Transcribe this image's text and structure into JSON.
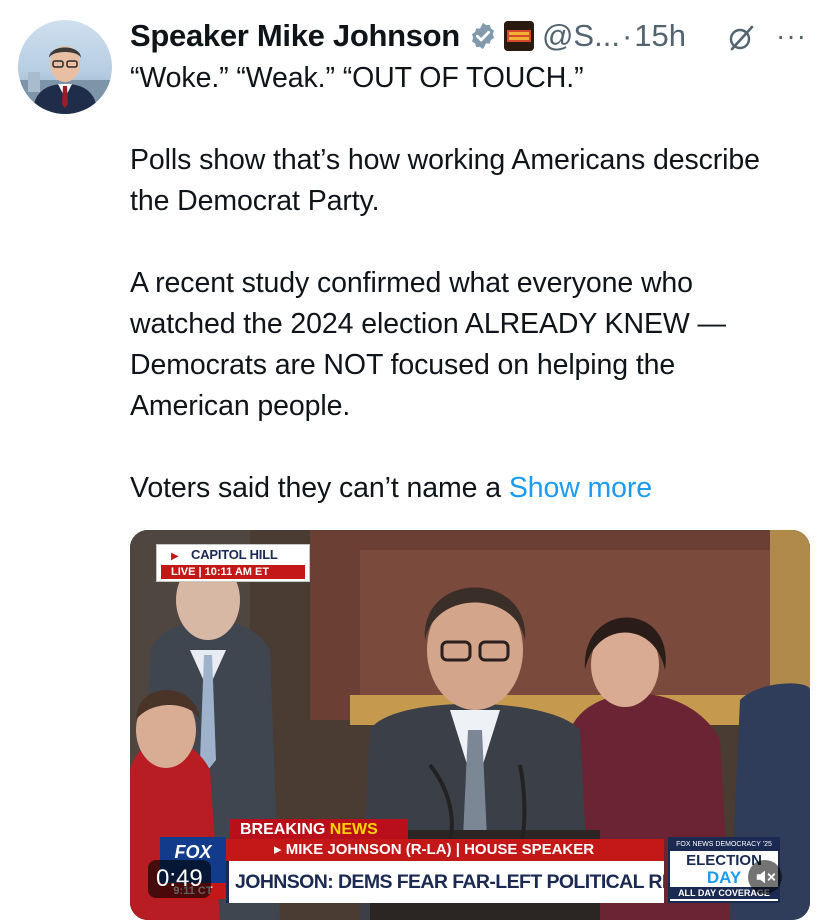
{
  "tweet": {
    "display_name": "Speaker Mike Johnson",
    "handle": "@S...",
    "separator": "·",
    "time": "15h",
    "more_label": "···",
    "body": "“Woke.” “Weak.” “OUT OF TOUCH.”\n\nPolls show that’s how working Americans describe the Democrat Party.\n\nA recent study confirmed what everyone who watched the 2024 election ALREADY KNEW — Democrats are NOT focused on helping the American people.\n\nVoters said they can’t name a ",
    "show_more": "Show more",
    "affiliate_badge_text": "THIS IS A DEMOCRAT",
    "icons": [
      "verified-badge-icon",
      "grok-icon",
      "more-icon",
      "mute-icon"
    ],
    "colors": {
      "link": "#1d9bf0",
      "verified": "#829aab",
      "secondary": "#536471"
    }
  },
  "video": {
    "duration": "0:49",
    "location": "CAPITOL HILL",
    "live": "LIVE",
    "live_time": "10:11 AM ET",
    "breaking": "BREAKING",
    "news": "NEWS",
    "speaker": "MIKE JOHNSON (R-LA) | HOUSE SPEAKER",
    "headline": "JOHNSON: DEMS FEAR FAR-LEFT POLITICAL RETRIBUTION",
    "network": "FOX",
    "clock": "9:11 CT",
    "election_top": "FOX NEWS DEMOCRACY '25",
    "election_1": "ELECTION",
    "election_2": "DAY",
    "election_3": "ALL DAY COVERAGE"
  }
}
